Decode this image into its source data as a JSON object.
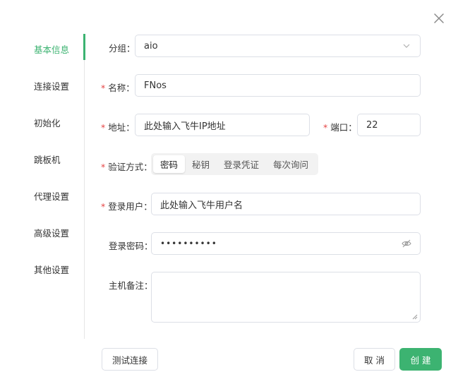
{
  "sidebar": {
    "items": [
      {
        "label": "基本信息",
        "active": true
      },
      {
        "label": "连接设置",
        "active": false
      },
      {
        "label": "初始化",
        "active": false
      },
      {
        "label": "跳板机",
        "active": false
      },
      {
        "label": "代理设置",
        "active": false
      },
      {
        "label": "高级设置",
        "active": false
      },
      {
        "label": "其他设置",
        "active": false
      }
    ]
  },
  "form": {
    "group": {
      "label": "分组：",
      "value": "aio",
      "icon": "chevron-down-icon"
    },
    "name": {
      "required_mark": "*",
      "label": "名称：",
      "value": "FNos"
    },
    "address": {
      "required_mark": "*",
      "label": "地址：",
      "value": "此处输入飞牛IP地址"
    },
    "port": {
      "required_mark": "*",
      "label": "端口：",
      "value": "22"
    },
    "auth": {
      "required_mark": "*",
      "label": "验证方式：",
      "options": [
        "密码",
        "秘钥",
        "登录凭证",
        "每次询问"
      ],
      "selected": "密码"
    },
    "user": {
      "required_mark": "*",
      "label": "登录用户：",
      "value": "此处输入飞牛用户名"
    },
    "password": {
      "label": "登录密码：",
      "value": "••••••••••",
      "icon": "eye-off-icon"
    },
    "remark": {
      "label": "主机备注：",
      "value": ""
    }
  },
  "footer": {
    "test_label": "测试连接",
    "cancel_label": "取 消",
    "create_label": "创 建"
  },
  "colors": {
    "accent": "#3cb371",
    "required": "#e54545",
    "border": "#dcdfe6"
  },
  "icons": {
    "close": "close-icon"
  }
}
